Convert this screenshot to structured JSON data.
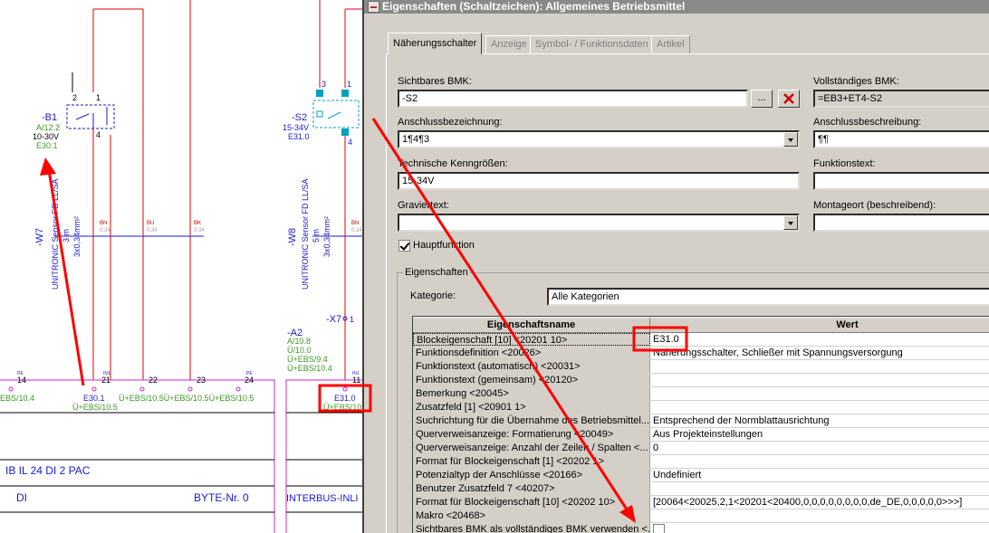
{
  "schematic": {
    "b1": {
      "tag": "-B1",
      "ref1": "A/12.2",
      "voltage": "10-30V",
      "ref2": "E30.1",
      "pin2": "2",
      "pin1": "1",
      "pin4": "4"
    },
    "s2": {
      "tag": "-S2",
      "voltage": "15-34V",
      "ref": "E31.0",
      "pin3": "3",
      "pin1": "1",
      "pin4": "4"
    },
    "w7": {
      "tag": "-W7",
      "type": "UNITRONIC Sensor FD LL/SA",
      "length": "3 m",
      "section": "3x0,34mm²",
      "cores": [
        "BN",
        "BU",
        "BK"
      ],
      "sizes": [
        "0,34",
        "0,34",
        "0,34"
      ]
    },
    "w8": {
      "tag": "-W8",
      "type": "UNITRONIC Sensor FD LL/SA",
      "length": "5 m",
      "section": "3x0,34mm²",
      "cores": [
        "BN",
        "BU",
        "BK"
      ],
      "sizes": [
        "0,34",
        "0,34",
        "0,34"
      ]
    },
    "x7": {
      "tag": "-X7",
      "pin": "1"
    },
    "a2": {
      "tag": "-A2",
      "refs": [
        "A/10.8",
        "Ü/10.0",
        "Ü+EBS/9.4",
        "Ü+EBS/10.4"
      ]
    },
    "terminals": [
      "14",
      "21",
      "22",
      "23",
      "24",
      "11"
    ],
    "terminal_small": [
      "PE",
      "IN1",
      "",
      "",
      "PE",
      "IN1"
    ],
    "xref_left": "EBS/10.4",
    "xref_e301": "E30.1",
    "xref_ue_10_5": "Ü+EBS/10.5",
    "xref_row": "Ü+EBS/10.5Ü+EBS/10.5Ü+EBS/10.5",
    "xref_e310": "E31.0",
    "xref_right": "Ü+EBS/10",
    "module_name": "IB IL 24 DI 2 PAC",
    "module_di": "DI",
    "module_byte": "BYTE-Nr. 0",
    "module_right": "INTERBUS-INLI"
  },
  "dialog": {
    "title": "Eigenschaften (Schaltzeichen): Allgemeines Betriebsmittel",
    "tabs": [
      "Näherungsschalter",
      "Anzeige",
      "Symbol- / Funktionsdaten",
      "Artikel"
    ],
    "fields": {
      "sichtbares_bmk_label": "Sichtbares BMK:",
      "sichtbares_bmk_value": "-S2",
      "browse_label": "...",
      "vollstaendiges_bmk_label": "Vollständiges BMK:",
      "vollstaendiges_bmk_value": "=EB3+ET4-S2",
      "anschlussbez_label": "Anschlussbezeichnung:",
      "anschlussbez_value": "1¶4¶3",
      "anschlussbeschr_label": "Anschlussbeschreibung:",
      "anschlussbeschr_value": "¶¶",
      "tech_label": "Technische Kenngrößen:",
      "tech_value": "15-34V",
      "funktionstext_label": "Funktionstext:",
      "funktionstext_value": "",
      "gravier_label": "Graviertext:",
      "gravier_value": "",
      "montage_label": "Montageort (beschreibend):",
      "montage_value": "",
      "hauptfunktion_label": "Hauptfunktion",
      "hauptfunktion_checked": true
    },
    "group_label": "Eigenschaften",
    "kategorie_label": "Kategorie:",
    "kategorie_value": "Alle Kategorien",
    "table": {
      "headers": [
        "Eigenschaftsname",
        "Wert"
      ],
      "rows": [
        {
          "name": "Blockeigenschaft [10] <20201 10>",
          "value": "E31.0"
        },
        {
          "name": "Funktionsdefinition <20026>",
          "value": "Näherungsschalter, Schließer mit Spannungsversorgung"
        },
        {
          "name": "Funktionstext (automatisch) <20031>",
          "value": ""
        },
        {
          "name": "Funktionstext (gemeinsam) <20120>",
          "value": ""
        },
        {
          "name": "Bemerkung <20045>",
          "value": ""
        },
        {
          "name": "Zusatzfeld [1] <20901 1>",
          "value": ""
        },
        {
          "name": "Suchrichtung für die Übernahme des Betriebsmittel...",
          "value": "Entsprechend der Normblattausrichtung"
        },
        {
          "name": "Querverweisanzeige: Formatierung <20049>",
          "value": "Aus Projekteinstellungen"
        },
        {
          "name": "Querverweisanzeige: Anzahl der Zeilen / Spalten <...",
          "value": "0"
        },
        {
          "name": "Format für Blockeigenschaft [1] <20202 1>",
          "value": ""
        },
        {
          "name": "Potenzialtyp der Anschlüsse <20166>",
          "value": "Undefiniert"
        },
        {
          "name": "Benutzer Zusatzfeld 7 <40207>",
          "value": ""
        },
        {
          "name": "Format für Blockeigenschaft [10] <20202 10>",
          "value": "[20064<20025,2,1<20201<20400,0,0,0,0,0,0,0,0,de_DE,0,0,0,0,0>>>]"
        },
        {
          "name": "Makro <20468>",
          "value": ""
        },
        {
          "name": "Sichtbares BMK als vollständiges BMK verwenden <...",
          "value": ""
        }
      ]
    }
  },
  "colors": {
    "wire": "#e00000",
    "green": "#3a9a20",
    "blue": "#1a1ad0",
    "magenta": "#d020d0",
    "annotation": "#ff0000"
  }
}
